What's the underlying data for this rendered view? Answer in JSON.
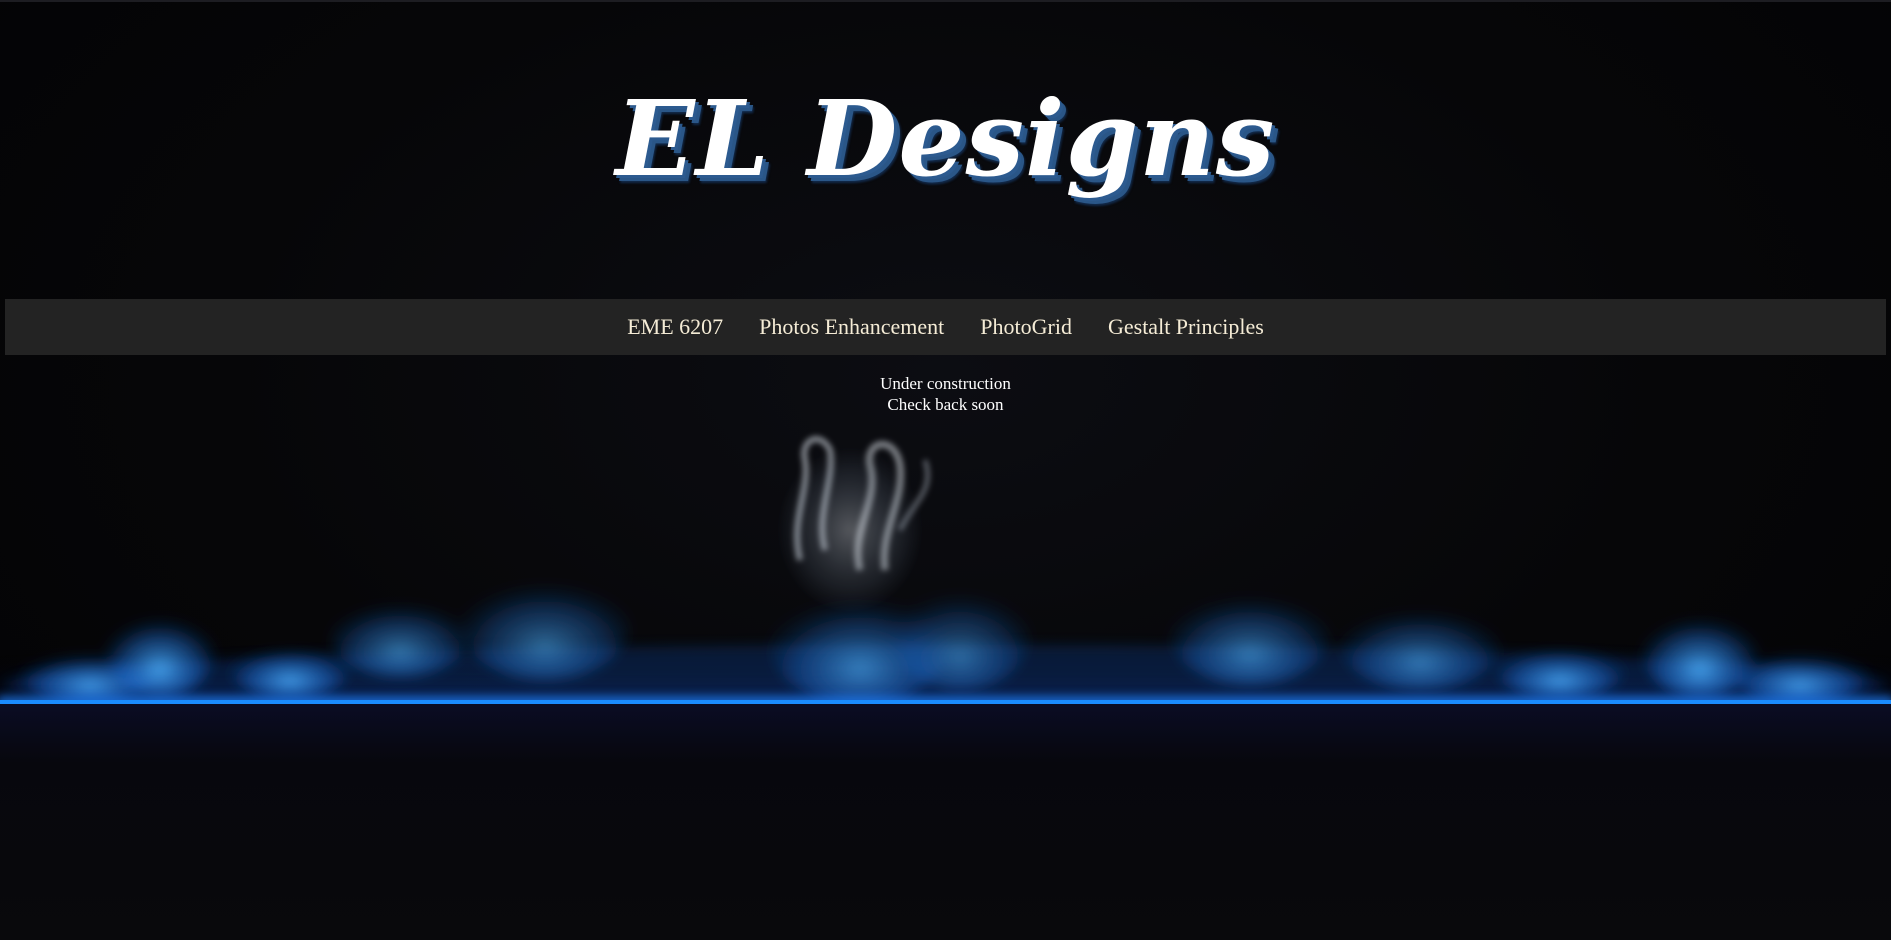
{
  "site": {
    "title": "EL Designs"
  },
  "nav": {
    "items": [
      {
        "label": "EME 6207"
      },
      {
        "label": "Photos Enhancement"
      },
      {
        "label": "PhotoGrid"
      },
      {
        "label": "Gestalt Principles"
      }
    ]
  },
  "main": {
    "notice_line1": "Under construction",
    "notice_line2": "Check back soon"
  },
  "colors": {
    "background": "#050507",
    "navbar": "#232323",
    "nav_text": "#f5ecd6",
    "title_shadow": "#2c5a8f",
    "glow": "#1a8cff"
  }
}
